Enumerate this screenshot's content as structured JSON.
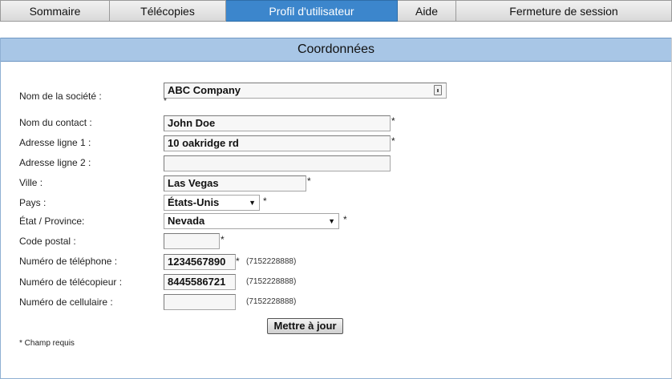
{
  "nav": {
    "tabs": [
      {
        "label": "Sommaire"
      },
      {
        "label": "Télécopies"
      },
      {
        "label": "Profil d'utilisateur"
      },
      {
        "label": "Aide"
      },
      {
        "label": "Fermeture de session"
      }
    ],
    "active_tab": "Profil d'utilisateur",
    "active_color": "#3c86cc"
  },
  "panel": {
    "title": "Coordonnées",
    "header_color": "#a8c6e6"
  },
  "form": {
    "company": {
      "label": "Nom de la société :",
      "value": "ABC Company",
      "required_mark": "*"
    },
    "contact": {
      "label": "Nom du contact :",
      "value": "John Doe",
      "required_mark": "*"
    },
    "address1": {
      "label": "Adresse ligne 1 :",
      "value": "10 oakridge rd",
      "required_mark": "*"
    },
    "address2": {
      "label": "Adresse ligne 2 :",
      "value": ""
    },
    "city": {
      "label": "Ville :",
      "value": "Las Vegas",
      "required_mark": "*"
    },
    "country": {
      "label": "Pays :",
      "value": "États-Unis",
      "required_mark": "*"
    },
    "state": {
      "label": "État / Province:",
      "value": "Nevada",
      "required_mark": "*"
    },
    "postal": {
      "label": "Code postal :",
      "value": "",
      "required_mark": "*"
    },
    "phone": {
      "label": "Numéro de téléphone :",
      "value": "1234567890",
      "required_mark": "*",
      "hint": "(7152228888)"
    },
    "fax": {
      "label": "Numéro de télécopieur :",
      "value": "8445586721",
      "hint": "(7152228888)"
    },
    "cell": {
      "label": "Numéro de cellulaire :",
      "value": "",
      "hint": "(7152228888)"
    },
    "submit_label": "Mettre à jour",
    "footnote": "* Champ requis"
  },
  "icons": {
    "dropdown": "chevron-down-icon",
    "company_field": "lock-icon"
  }
}
